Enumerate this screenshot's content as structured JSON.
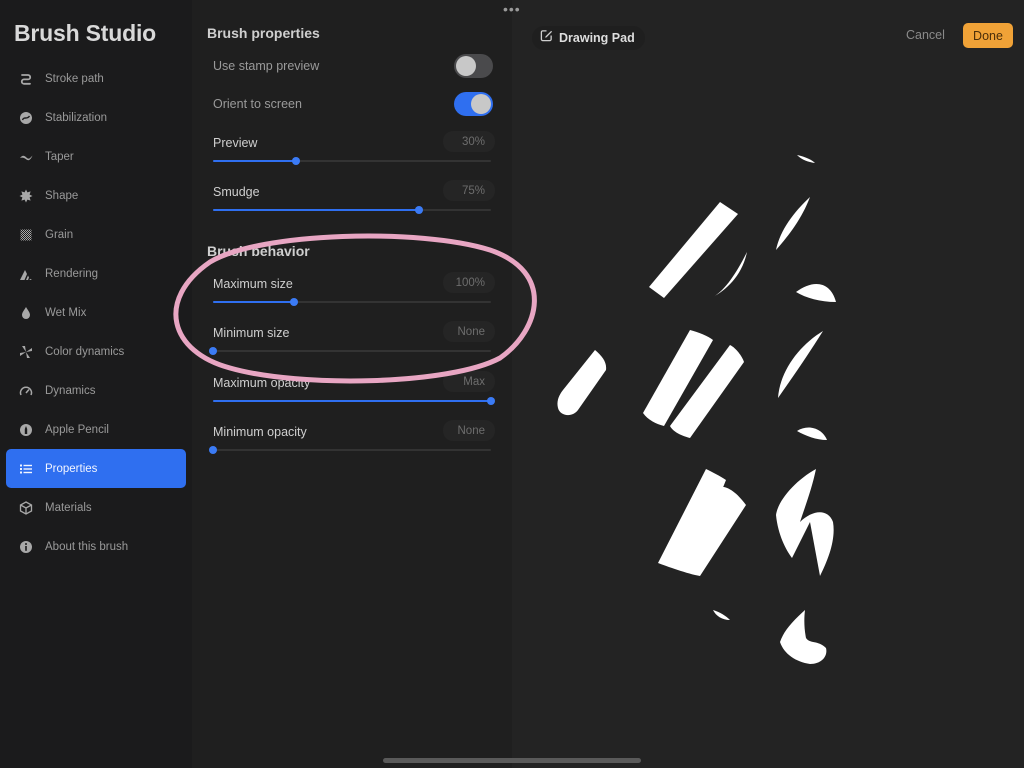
{
  "app_title": "Brush Studio",
  "sidebar": {
    "items": [
      {
        "label": "Stroke path",
        "icon": "stroke-path-icon"
      },
      {
        "label": "Stabilization",
        "icon": "stabilization-icon"
      },
      {
        "label": "Taper",
        "icon": "taper-icon"
      },
      {
        "label": "Shape",
        "icon": "shape-icon"
      },
      {
        "label": "Grain",
        "icon": "grain-icon"
      },
      {
        "label": "Rendering",
        "icon": "rendering-icon"
      },
      {
        "label": "Wet Mix",
        "icon": "wet-mix-icon"
      },
      {
        "label": "Color dynamics",
        "icon": "color-dynamics-icon"
      },
      {
        "label": "Dynamics",
        "icon": "dynamics-icon"
      },
      {
        "label": "Apple Pencil",
        "icon": "apple-pencil-icon"
      },
      {
        "label": "Properties",
        "icon": "properties-icon",
        "active": true
      },
      {
        "label": "Materials",
        "icon": "materials-icon"
      },
      {
        "label": "About this brush",
        "icon": "info-icon"
      }
    ]
  },
  "panel": {
    "brush_properties": {
      "title": "Brush properties",
      "toggles": [
        {
          "label": "Use stamp preview",
          "on": false
        },
        {
          "label": "Orient to screen",
          "on": true
        }
      ],
      "sliders": [
        {
          "label": "Preview",
          "value": "30%",
          "fraction": 0.3
        },
        {
          "label": "Smudge",
          "value": "75%",
          "fraction": 0.74
        }
      ]
    },
    "brush_behavior": {
      "title": "Brush behavior",
      "sliders": [
        {
          "label": "Maximum size",
          "value": "100%",
          "fraction": 0.29
        },
        {
          "label": "Minimum size",
          "value": "None",
          "fraction": 0.0
        },
        {
          "label": "Maximum opacity",
          "value": "Max",
          "fraction": 1.0
        },
        {
          "label": "Minimum opacity",
          "value": "None",
          "fraction": 0.0
        }
      ]
    }
  },
  "drawing_pad": {
    "label": "Drawing Pad",
    "cancel_label": "Cancel",
    "done_label": "Done"
  },
  "colors": {
    "accent": "#2f6ff0",
    "done": "#f0a237",
    "annotation": "#e8a6c3"
  }
}
